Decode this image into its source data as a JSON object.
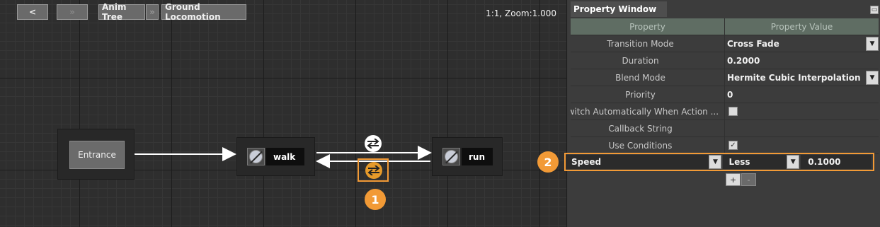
{
  "toolbar": {
    "back_label": "<",
    "forward_label": "»",
    "breadcrumbs": [
      "Anim Tree",
      "Ground Locomotion"
    ],
    "breadcrumb_separator": "»",
    "zoom_readout": "1:1, Zoom:1.000"
  },
  "graph": {
    "entrance_label": "Entrance",
    "states": [
      {
        "label": "walk"
      },
      {
        "label": "run"
      }
    ],
    "transition_icon": "swap-arrows-icon",
    "callout_1": "1",
    "accent_color": "#f29a36"
  },
  "property_window": {
    "title": "Property Window",
    "header": {
      "property": "Property",
      "value": "Property Value"
    },
    "rows": [
      {
        "name": "Transition Mode",
        "value": "Cross Fade"
      },
      {
        "name": "Duration",
        "value": "0.2000"
      },
      {
        "name": "Blend Mode",
        "value": "Hermite Cubic Interpolation"
      },
      {
        "name": "Priority",
        "value": "0"
      },
      {
        "name": "Switch Automatically When Action ...",
        "value": ""
      },
      {
        "name": "Callback String",
        "value": ""
      },
      {
        "name": "Use Conditions",
        "value": ""
      }
    ],
    "condition": {
      "parameter": "Speed",
      "operator": "Less",
      "value": "0.1000"
    },
    "add_label": "+",
    "remove_label": "-",
    "callout_2": "2"
  }
}
